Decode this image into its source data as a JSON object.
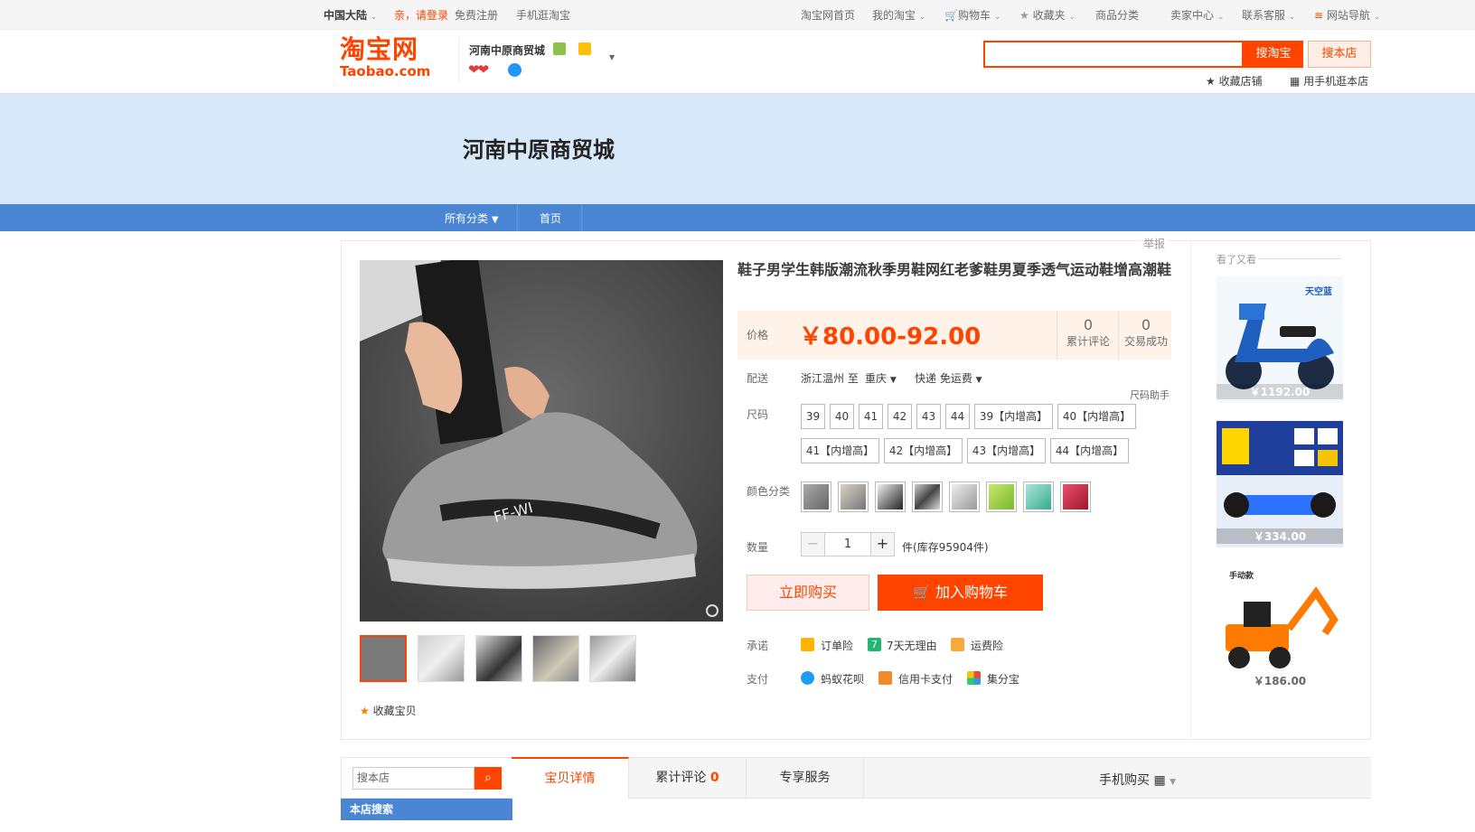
{
  "topbar": {
    "region": "中国大陆",
    "greeting": "亲，请登录",
    "register": "免费注册",
    "mobile": "手机逛淘宝",
    "home": "淘宝网首页",
    "my_taobao": "我的淘宝",
    "cart": "购物车",
    "favorites": "收藏夹",
    "categories": "商品分类",
    "seller": "卖家中心",
    "contact": "联系客服",
    "sitenav": "网站导航"
  },
  "header": {
    "logo_cn": "淘宝网",
    "logo_en": "Taobao.com",
    "shop_name": "河南中原商贸城",
    "search_taobao": "搜淘宝",
    "search_shop": "搜本店",
    "fav_shop": "收藏店铺",
    "mobile_shop": "用手机逛本店"
  },
  "banner": {
    "title": "河南中原商贸城"
  },
  "nav": {
    "all_categories": "所有分类",
    "home": "首页"
  },
  "product": {
    "report": "举报",
    "title": "鞋子男学生韩版潮流秋季男鞋网红老爹鞋男夏季透气运动鞋增高潮鞋",
    "price_label": "价格",
    "price": "￥80.00-92.00",
    "reviews_count": "0",
    "reviews_label": "累计评论",
    "sales_count": "0",
    "sales_label": "交易成功",
    "ship_label": "配送",
    "ship_from": "浙江温州 至",
    "ship_to": "重庆",
    "ship_method": "快递 免运费",
    "size_helper": "尺码助手",
    "size_label": "尺码",
    "sizes": [
      "39",
      "40",
      "41",
      "42",
      "43",
      "44",
      "39【内增高】",
      "40【内增高】",
      "41【内增高】",
      "42【内增高】",
      "43【内增高】",
      "44【内增高】"
    ],
    "color_label": "颜色分类",
    "qty_label": "数量",
    "qty": "1",
    "stock": "件(库存95904件)",
    "buy_now": "立即购买",
    "add_cart": "加入购物车",
    "promise_label": "承诺",
    "promises": [
      "订单险",
      "7天无理由",
      "运费险"
    ],
    "pay_label": "支付",
    "payments": [
      "蚂蚁花呗",
      "信用卡支付",
      "集分宝"
    ],
    "fav_item": "收藏宝贝"
  },
  "sidebar": {
    "title": "看了又看",
    "items": [
      {
        "price": "￥1192.00",
        "tag": "天空蓝"
      },
      {
        "price": "￥334.00"
      },
      {
        "price": "￥186.00",
        "tag": "手动款"
      }
    ]
  },
  "shop_search": {
    "placeholder": "搜本店",
    "section": "本店搜索"
  },
  "tabs": {
    "detail": "宝贝详情",
    "reviews": "累计评论",
    "reviews_count": "0",
    "service": "专享服务",
    "mobile_buy": "手机购买"
  },
  "colors": {
    "accent": "#ff4400",
    "nav": "#4a86d3",
    "banner": "#d7e8f8"
  }
}
